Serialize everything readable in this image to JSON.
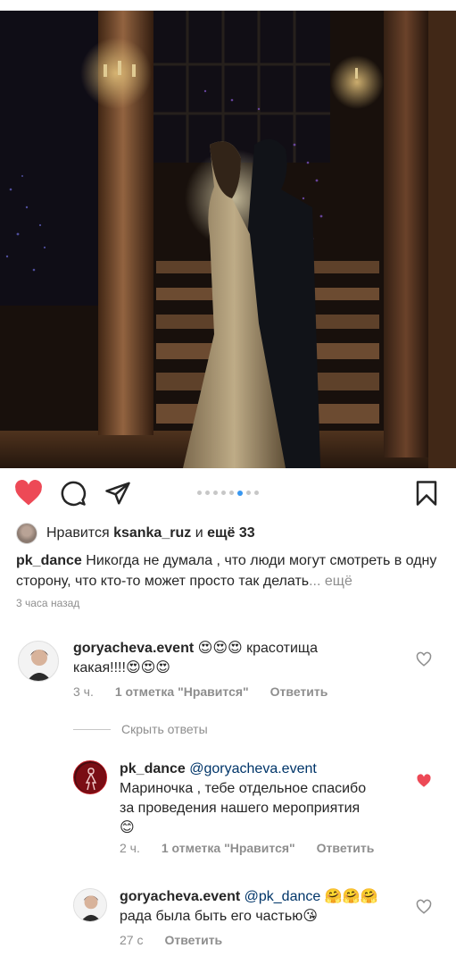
{
  "post": {
    "photo_alt_icon": "wedding-photo",
    "carousel": {
      "count": 8,
      "active_index": 5
    },
    "likes": {
      "prefix": "Нравится",
      "user": "ksanka_ruz",
      "joiner": "и",
      "others": "ещё 33"
    },
    "caption": {
      "author": "pk_dance",
      "text": "Никогда не думала , что люди могут смотреть в одну сторону, что кто-то может просто так делать",
      "more": "... ещё"
    },
    "time_ago": "3 часа назад"
  },
  "comments": [
    {
      "author": "goryacheva.event",
      "text_a": "😍😍😍 красотища",
      "text_b": "какая!!!!😍😍😍",
      "time": "3 ч.",
      "likes": "1 отметка \"Нравится\"",
      "reply": "Ответить",
      "liked": false
    }
  ],
  "hide_replies": "Скрыть ответы",
  "replies": [
    {
      "author": "pk_dance",
      "mention": "@goryacheva.event",
      "line1": "Мариночка , тебе отдельное спасибо",
      "line2": "за проведения нашего мероприятия",
      "line3": "😊",
      "time": "2 ч.",
      "likes": "1 отметка \"Нравится\"",
      "reply": "Ответить",
      "liked": true
    },
    {
      "author": "goryacheva.event",
      "mention": "@pk_dance",
      "emoji": "🤗🤗🤗",
      "line2": "рада была быть его частью😘",
      "time": "27 с",
      "reply": "Ответить",
      "liked": false
    }
  ],
  "colors": {
    "like_red": "#ed4956",
    "muted": "#8e8e8e",
    "carousel_active": "#3897f0",
    "mention": "#003569"
  }
}
